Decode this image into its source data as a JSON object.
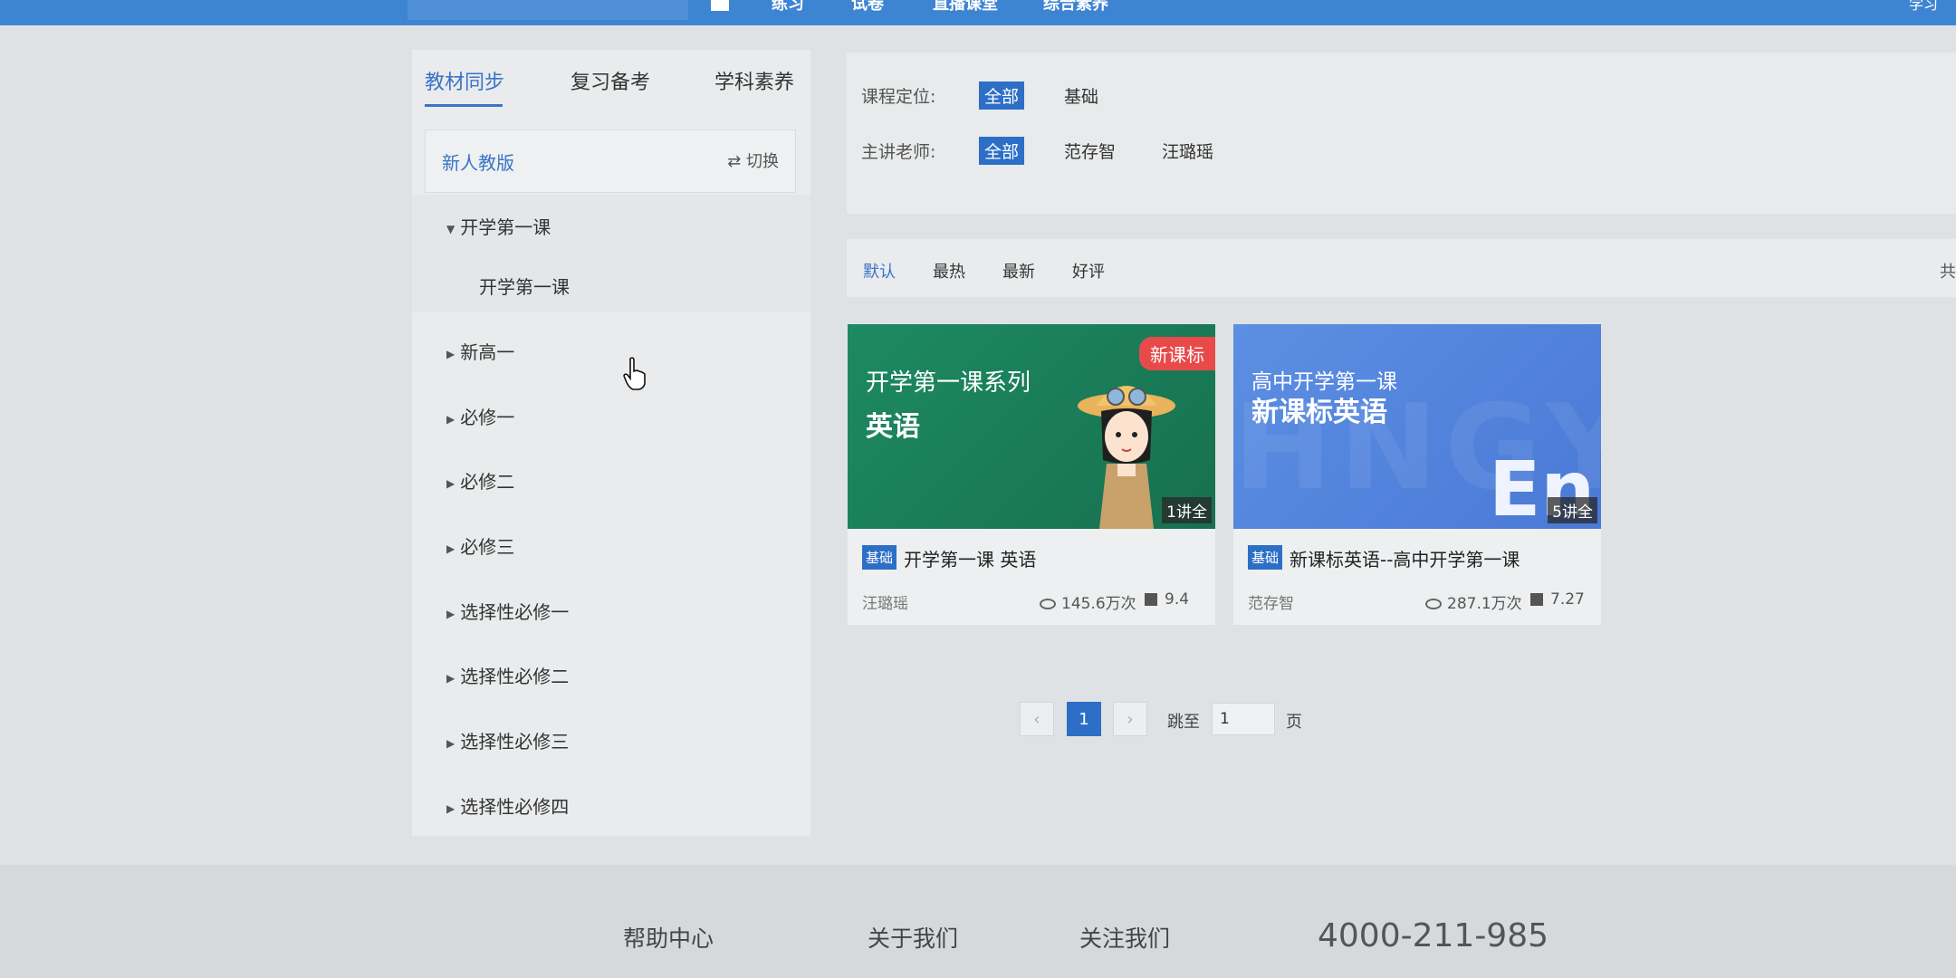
{
  "header": {
    "nav": [
      "练习",
      "试卷",
      "直播课堂",
      "综合素养"
    ],
    "user": "学习"
  },
  "sidebar": {
    "tabs": [
      "教材同步",
      "复习备考",
      "学科素养"
    ],
    "edition": "新人教版",
    "switch_label": "⇄ 切换",
    "open_chapter": "开学第一课",
    "open_child": "开学第一课",
    "chapters": [
      "新高一",
      "必修一",
      "必修二",
      "必修三",
      "选择性必修一",
      "选择性必修二",
      "选择性必修三",
      "选择性必修四"
    ]
  },
  "filters": {
    "positioning_label": "课程定位:",
    "positioning_options": [
      "全部",
      "基础"
    ],
    "teacher_label": "主讲老师:",
    "teacher_options": [
      "全部",
      "范存智",
      "汪璐瑶"
    ]
  },
  "sort": {
    "options": [
      "默认",
      "最热",
      "最新",
      "好评"
    ],
    "extra": "共"
  },
  "courses": [
    {
      "ribbon": "新课标",
      "thumb_line1": "开学第一课系列",
      "thumb_line2": "英语",
      "lectures": "1讲全",
      "badge": "基础",
      "title": "开学第一课 英语",
      "teacher": "汪璐瑶",
      "views": "145.6万次",
      "rating": "9.4"
    },
    {
      "thumb_line1": "高中开学第一课",
      "thumb_line2": "新课标英语",
      "thumb_mark": "En",
      "thumb_bgword": "HNGYU",
      "lectures": "5讲全",
      "badge": "基础",
      "title": "新课标英语--高中开学第一课",
      "teacher": "范存智",
      "views": "287.1万次",
      "rating": "7.27"
    }
  ],
  "pagination": {
    "prev": "‹",
    "current": "1",
    "next": "›",
    "jump_label": "跳至",
    "jump_value": "1",
    "page_unit": "页"
  },
  "footer": {
    "links": [
      "帮助中心",
      "关于我们",
      "关注我们"
    ],
    "phone": "4000-211-985"
  },
  "colors": {
    "accent": "#2d6fc7",
    "topbar": "#3d84d2",
    "ribbon": "#e84a4a"
  }
}
